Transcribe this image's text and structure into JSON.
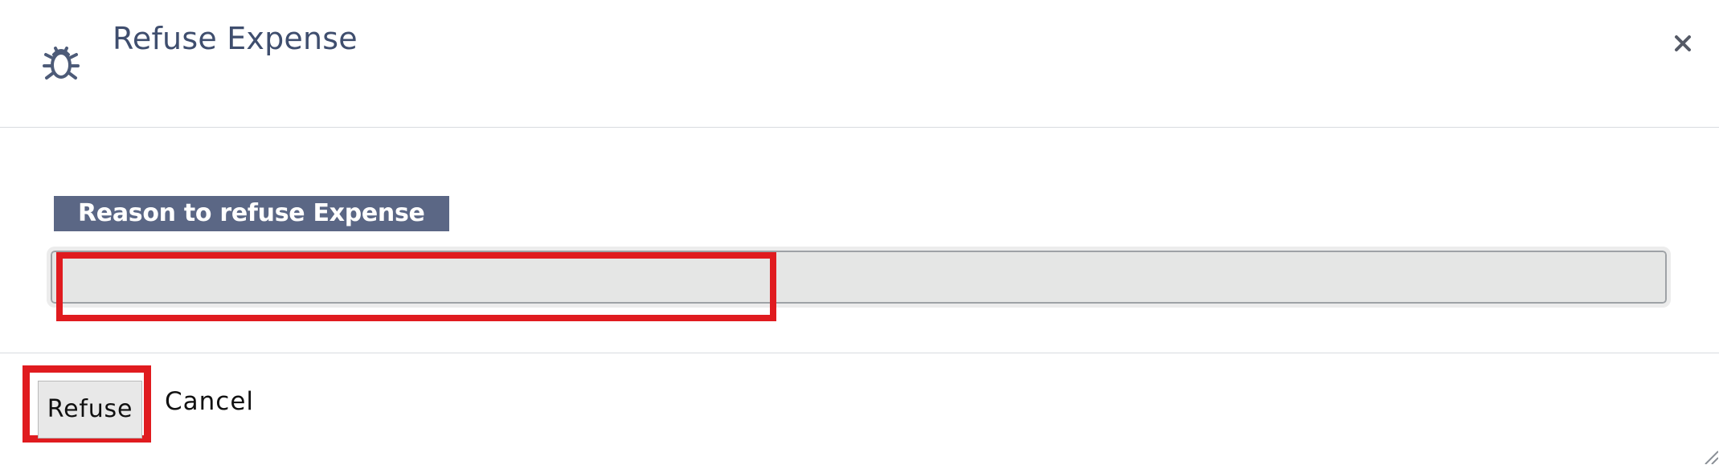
{
  "dialog": {
    "title": "Refuse Expense",
    "icon": "bug-icon",
    "close_icon": "close-icon"
  },
  "form": {
    "reason_label": "Reason to refuse Expense",
    "reason_value": "",
    "reason_placeholder": ""
  },
  "footer": {
    "refuse_label": "Refuse",
    "cancel_label": "Cancel"
  },
  "colors": {
    "title_text": "#3f4e6e",
    "label_background": "#5b6785",
    "input_background": "#e5e6e5",
    "highlight": "#e01b1f"
  }
}
